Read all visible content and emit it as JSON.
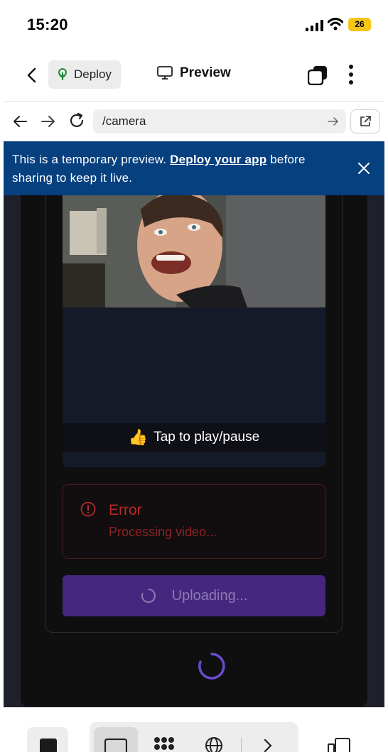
{
  "status_bar": {
    "time": "15:20",
    "battery": "26"
  },
  "header": {
    "deploy_label": "Deploy",
    "preview_label": "Preview"
  },
  "url_bar": {
    "url": "/camera"
  },
  "banner": {
    "text_before": "This is a temporary preview. ",
    "link_text": "Deploy your app",
    "text_after": " before sharing to keep it live."
  },
  "video": {
    "overlay_emoji": "👍",
    "overlay_label": "Tap to play/pause"
  },
  "error": {
    "title": "Error",
    "message": "Processing video..."
  },
  "upload_button": {
    "label": "Uploading..."
  },
  "colors": {
    "banner_bg": "#06407f",
    "error_text": "#b52a2a",
    "upload_bg": "#45277f",
    "spinner": "#6a4bd0"
  },
  "icons": {
    "status": [
      "signal-icon",
      "wifi-icon",
      "battery-icon"
    ],
    "header": [
      "back-arrow-icon",
      "sprout-icon",
      "monitor-icon",
      "tabs-icon",
      "more-vertical-icon"
    ],
    "url_bar": [
      "arrow-left-icon",
      "arrow-right-icon",
      "reload-icon",
      "go-arrow-icon",
      "external-link-icon"
    ],
    "bottom_bar": [
      "stop-icon",
      "monitor-icon",
      "apps-icon",
      "globe-icon",
      "chevron-right-icon",
      "devices-icon"
    ]
  }
}
